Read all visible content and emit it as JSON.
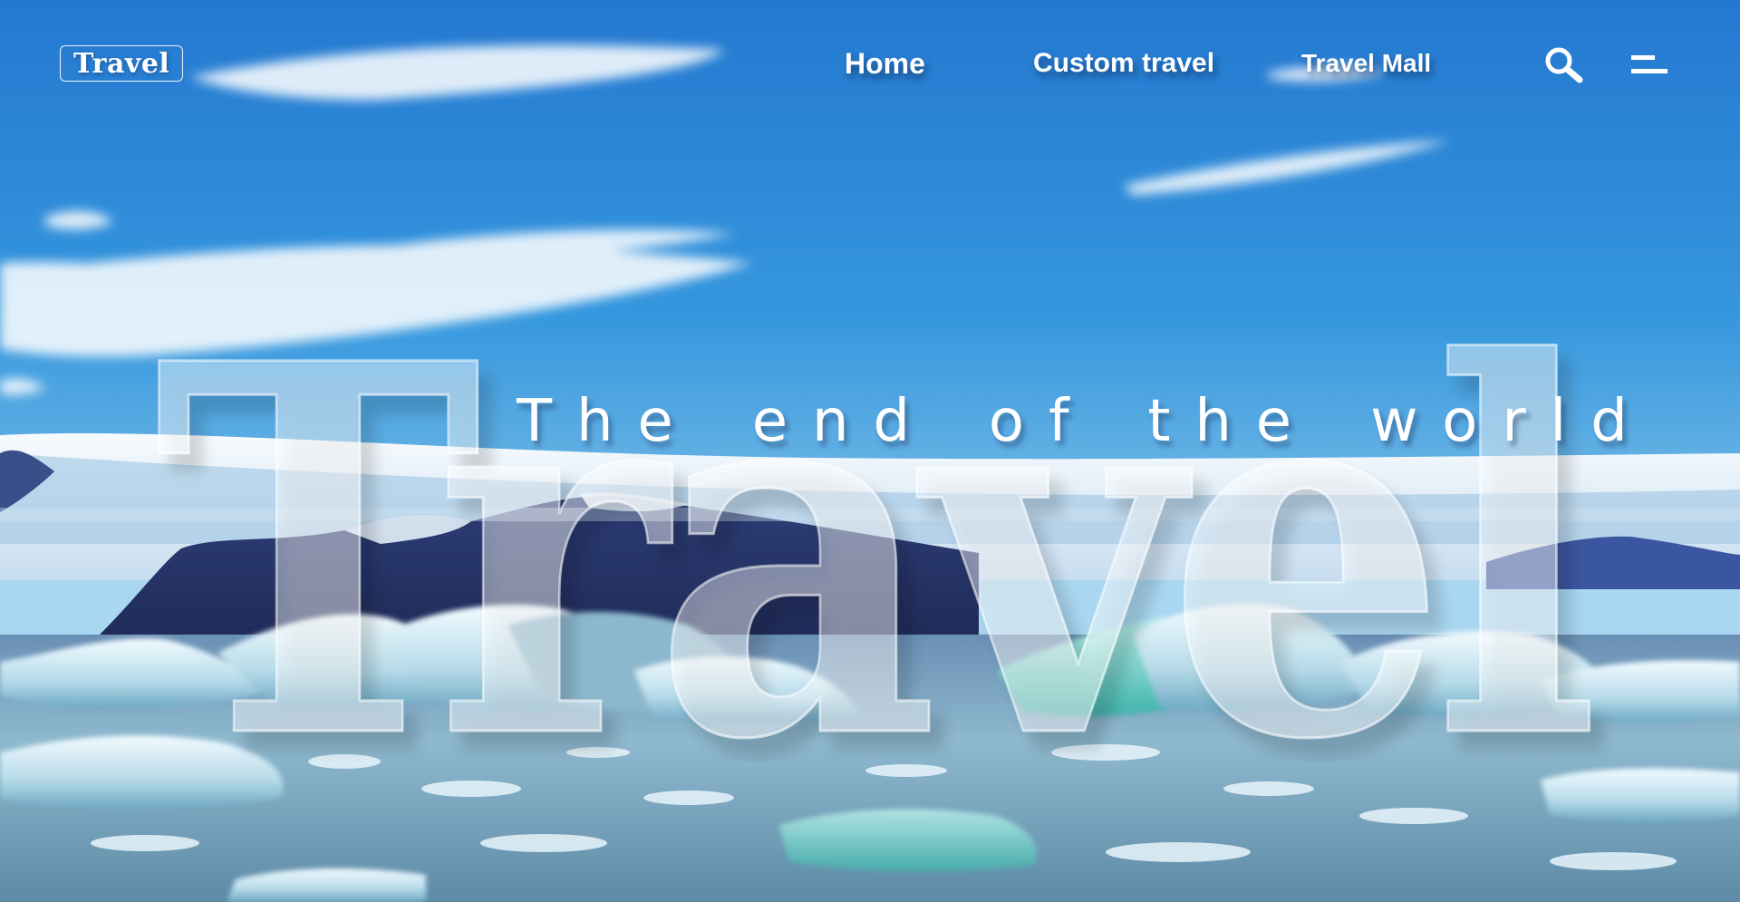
{
  "header": {
    "logo_text": "Travel",
    "nav": {
      "home": "Home",
      "custom_travel": "Custom travel",
      "travel_mall": "Travel Mall"
    },
    "icons": {
      "search": "search-icon",
      "menu": "menu-icon"
    }
  },
  "hero": {
    "tagline": "The end of the world",
    "big_word": "Travel"
  },
  "colors": {
    "sky_top": "#2a86d6",
    "sky_bottom": "#7bc4ec",
    "text": "#ffffff",
    "ice": "#d9eef6",
    "glacier_water": "#5fc7c0"
  }
}
